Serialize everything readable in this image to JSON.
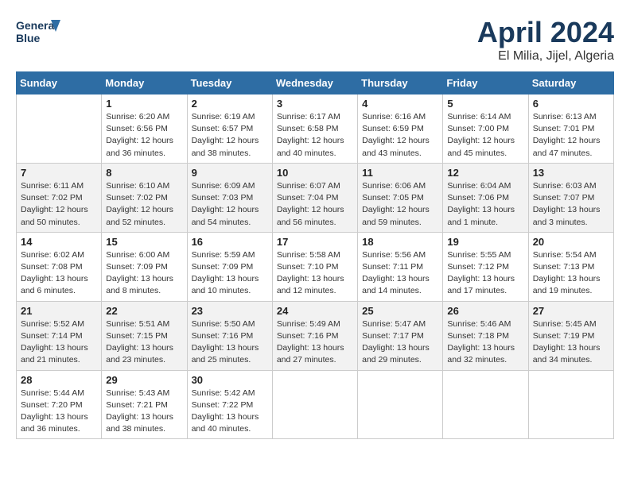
{
  "header": {
    "logo_line1": "General",
    "logo_line2": "Blue",
    "month": "April 2024",
    "location": "El Milia, Jijel, Algeria"
  },
  "days_of_week": [
    "Sunday",
    "Monday",
    "Tuesday",
    "Wednesday",
    "Thursday",
    "Friday",
    "Saturday"
  ],
  "weeks": [
    [
      {
        "num": "",
        "empty": true
      },
      {
        "num": "1",
        "sunrise": "6:20 AM",
        "sunset": "6:56 PM",
        "daylight": "12 hours and 36 minutes."
      },
      {
        "num": "2",
        "sunrise": "6:19 AM",
        "sunset": "6:57 PM",
        "daylight": "12 hours and 38 minutes."
      },
      {
        "num": "3",
        "sunrise": "6:17 AM",
        "sunset": "6:58 PM",
        "daylight": "12 hours and 40 minutes."
      },
      {
        "num": "4",
        "sunrise": "6:16 AM",
        "sunset": "6:59 PM",
        "daylight": "12 hours and 43 minutes."
      },
      {
        "num": "5",
        "sunrise": "6:14 AM",
        "sunset": "7:00 PM",
        "daylight": "12 hours and 45 minutes."
      },
      {
        "num": "6",
        "sunrise": "6:13 AM",
        "sunset": "7:01 PM",
        "daylight": "12 hours and 47 minutes."
      }
    ],
    [
      {
        "num": "7",
        "sunrise": "6:11 AM",
        "sunset": "7:02 PM",
        "daylight": "12 hours and 50 minutes."
      },
      {
        "num": "8",
        "sunrise": "6:10 AM",
        "sunset": "7:02 PM",
        "daylight": "12 hours and 52 minutes."
      },
      {
        "num": "9",
        "sunrise": "6:09 AM",
        "sunset": "7:03 PM",
        "daylight": "12 hours and 54 minutes."
      },
      {
        "num": "10",
        "sunrise": "6:07 AM",
        "sunset": "7:04 PM",
        "daylight": "12 hours and 56 minutes."
      },
      {
        "num": "11",
        "sunrise": "6:06 AM",
        "sunset": "7:05 PM",
        "daylight": "12 hours and 59 minutes."
      },
      {
        "num": "12",
        "sunrise": "6:04 AM",
        "sunset": "7:06 PM",
        "daylight": "13 hours and 1 minute."
      },
      {
        "num": "13",
        "sunrise": "6:03 AM",
        "sunset": "7:07 PM",
        "daylight": "13 hours and 3 minutes."
      }
    ],
    [
      {
        "num": "14",
        "sunrise": "6:02 AM",
        "sunset": "7:08 PM",
        "daylight": "13 hours and 6 minutes."
      },
      {
        "num": "15",
        "sunrise": "6:00 AM",
        "sunset": "7:09 PM",
        "daylight": "13 hours and 8 minutes."
      },
      {
        "num": "16",
        "sunrise": "5:59 AM",
        "sunset": "7:09 PM",
        "daylight": "13 hours and 10 minutes."
      },
      {
        "num": "17",
        "sunrise": "5:58 AM",
        "sunset": "7:10 PM",
        "daylight": "13 hours and 12 minutes."
      },
      {
        "num": "18",
        "sunrise": "5:56 AM",
        "sunset": "7:11 PM",
        "daylight": "13 hours and 14 minutes."
      },
      {
        "num": "19",
        "sunrise": "5:55 AM",
        "sunset": "7:12 PM",
        "daylight": "13 hours and 17 minutes."
      },
      {
        "num": "20",
        "sunrise": "5:54 AM",
        "sunset": "7:13 PM",
        "daylight": "13 hours and 19 minutes."
      }
    ],
    [
      {
        "num": "21",
        "sunrise": "5:52 AM",
        "sunset": "7:14 PM",
        "daylight": "13 hours and 21 minutes."
      },
      {
        "num": "22",
        "sunrise": "5:51 AM",
        "sunset": "7:15 PM",
        "daylight": "13 hours and 23 minutes."
      },
      {
        "num": "23",
        "sunrise": "5:50 AM",
        "sunset": "7:16 PM",
        "daylight": "13 hours and 25 minutes."
      },
      {
        "num": "24",
        "sunrise": "5:49 AM",
        "sunset": "7:16 PM",
        "daylight": "13 hours and 27 minutes."
      },
      {
        "num": "25",
        "sunrise": "5:47 AM",
        "sunset": "7:17 PM",
        "daylight": "13 hours and 29 minutes."
      },
      {
        "num": "26",
        "sunrise": "5:46 AM",
        "sunset": "7:18 PM",
        "daylight": "13 hours and 32 minutes."
      },
      {
        "num": "27",
        "sunrise": "5:45 AM",
        "sunset": "7:19 PM",
        "daylight": "13 hours and 34 minutes."
      }
    ],
    [
      {
        "num": "28",
        "sunrise": "5:44 AM",
        "sunset": "7:20 PM",
        "daylight": "13 hours and 36 minutes."
      },
      {
        "num": "29",
        "sunrise": "5:43 AM",
        "sunset": "7:21 PM",
        "daylight": "13 hours and 38 minutes."
      },
      {
        "num": "30",
        "sunrise": "5:42 AM",
        "sunset": "7:22 PM",
        "daylight": "13 hours and 40 minutes."
      },
      {
        "num": "",
        "empty": true
      },
      {
        "num": "",
        "empty": true
      },
      {
        "num": "",
        "empty": true
      },
      {
        "num": "",
        "empty": true
      }
    ]
  ],
  "labels": {
    "sunrise_prefix": "Sunrise: ",
    "sunset_prefix": "Sunset: ",
    "daylight_prefix": "Daylight: "
  }
}
